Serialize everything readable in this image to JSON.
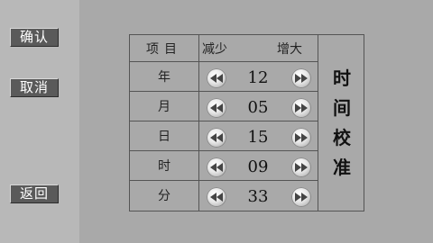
{
  "sidebar": {
    "confirm_label": "确认",
    "cancel_label": "取消",
    "back_label": "返回"
  },
  "table": {
    "header": {
      "item": "项目",
      "decrease": "减少",
      "increase": "增大"
    },
    "rows": [
      {
        "label": "年",
        "value": "12"
      },
      {
        "label": "月",
        "value": "05"
      },
      {
        "label": "日",
        "value": "15"
      },
      {
        "label": "时",
        "value": "09"
      },
      {
        "label": "分",
        "value": "33"
      }
    ]
  },
  "title_chars": [
    "时",
    "间",
    "校",
    "准"
  ]
}
